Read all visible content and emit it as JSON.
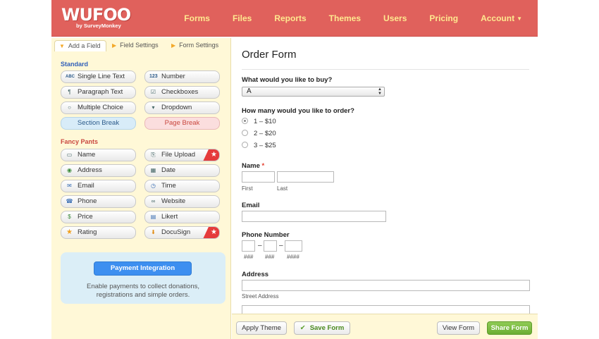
{
  "header": {
    "logo": "WUFOO",
    "logo_sub": "by SurveyMonkey",
    "nav": [
      "Forms",
      "Files",
      "Reports",
      "Themes",
      "Users",
      "Pricing",
      "Account"
    ]
  },
  "left": {
    "tabs": [
      "Add a Field",
      "Field Settings",
      "Form Settings"
    ],
    "standard_title": "Standard",
    "standard": {
      "single_line": "Single Line Text",
      "number": "Number",
      "paragraph": "Paragraph Text",
      "checkboxes": "Checkboxes",
      "multiple_choice": "Multiple Choice",
      "dropdown": "Dropdown",
      "section_break": "Section Break",
      "page_break": "Page Break"
    },
    "fancy_title": "Fancy Pants",
    "fancy": {
      "name": "Name",
      "file_upload": "File Upload",
      "address": "Address",
      "date": "Date",
      "email": "Email",
      "time": "Time",
      "phone": "Phone",
      "website": "Website",
      "price": "Price",
      "likert": "Likert",
      "rating": "Rating",
      "docusign": "DocuSign"
    },
    "payment": {
      "button": "Payment Integration",
      "text": "Enable payments to collect donations, registrations and simple orders."
    }
  },
  "form": {
    "title": "Order Form",
    "q1": "What would you like to buy?",
    "q1_value": "A",
    "q2": "How many would you like to order?",
    "options": [
      "1 – $10",
      "2 – $20",
      "3 – $25"
    ],
    "selected_option": "1 – $10",
    "name_label": "Name",
    "name_required": "*",
    "first": "First",
    "last": "Last",
    "email_label": "Email",
    "phone_label": "Phone Number",
    "phone_sub": [
      "###",
      "###",
      "####"
    ],
    "phone_dash": "–",
    "address_label": "Address",
    "street": "Street Address"
  },
  "footer": {
    "apply_theme": "Apply Theme",
    "save_form": "Save Form",
    "view_form": "View Form",
    "share_form": "Share Form"
  },
  "colors": {
    "header": "#e0615c",
    "nav_text": "#ffe98f",
    "panel": "#fff8d7",
    "payment_button": "#3d8ff0",
    "share_button": "#7dbd43"
  },
  "icons": {
    "single_line": "abc-icon",
    "number": "123-icon",
    "paragraph": "paragraph-icon",
    "checkboxes": "checkbox-icon",
    "multiple_choice": "radio-icon",
    "dropdown": "dropdown-icon",
    "name": "name-card-icon",
    "file_upload": "file-upload-icon",
    "address": "globe-icon",
    "date": "calendar-icon",
    "email": "envelope-icon",
    "time": "clock-icon",
    "phone": "phone-icon",
    "website": "link-icon",
    "price": "money-icon",
    "likert": "grid-icon",
    "rating": "star-icon",
    "docusign": "docusign-icon"
  }
}
